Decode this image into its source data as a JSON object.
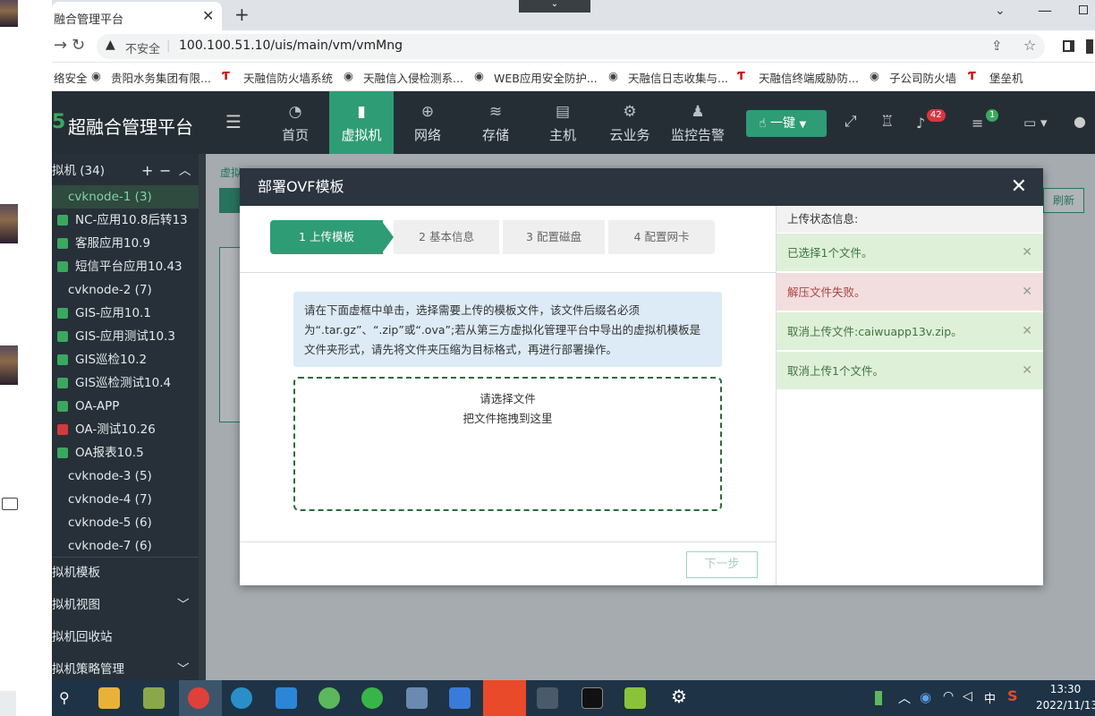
{
  "browser": {
    "tab_title": "融合管理平台",
    "security_label": "不安全",
    "url": "100.100.51.10/uis/main/vm/vmMng",
    "bookmarks": [
      "络安全",
      "贵阳水务集团有限...",
      "天融信防火墙系统",
      "天融信入侵检测系...",
      "WEB应用安全防护...",
      "天融信日志收集与...",
      "天融信终端威胁防...",
      "子公司防火墙",
      "堡垒机"
    ]
  },
  "app": {
    "logo_text": "超融合管理平台",
    "nav": [
      "首页",
      "虚拟机",
      "网络",
      "存储",
      "主机",
      "云业务",
      "监控告警"
    ],
    "one_click_label": "一键",
    "alarm_badge": "42",
    "task_badge": "1"
  },
  "sidebar": {
    "header": "拟机 (34)",
    "items": [
      {
        "label": "cvknode-1 (3)",
        "type": "host"
      },
      {
        "label": "NC-应用10.8后转13",
        "type": "vm"
      },
      {
        "label": "客服应用10.9",
        "type": "vm"
      },
      {
        "label": "短信平台应用10.43",
        "type": "vm"
      },
      {
        "label": "cvknode-2 (7)",
        "type": "host"
      },
      {
        "label": "GIS-应用10.1",
        "type": "vm"
      },
      {
        "label": "GIS-应用测试10.3",
        "type": "vm"
      },
      {
        "label": "GIS巡检10.2",
        "type": "vm"
      },
      {
        "label": "GIS巡检测试10.4",
        "type": "vm"
      },
      {
        "label": "OA-APP",
        "type": "vm"
      },
      {
        "label": "OA-测试10.26",
        "type": "vm-off"
      },
      {
        "label": "OA报表10.5",
        "type": "vm"
      },
      {
        "label": "cvknode-3 (5)",
        "type": "host"
      },
      {
        "label": "cvknode-4 (7)",
        "type": "host"
      },
      {
        "label": "cvknode-5 (6)",
        "type": "host"
      },
      {
        "label": "cvknode-7 (6)",
        "type": "host"
      }
    ],
    "sections": [
      "拟机模板",
      "拟机视图",
      "拟机回收站",
      "拟机策略管理"
    ]
  },
  "main": {
    "breadcrumb": "虚拟",
    "refresh_label": "刷新"
  },
  "modal": {
    "title": "部署OVF模板",
    "steps": [
      "1 上传模板",
      "2 基本信息",
      "3 配置磁盘",
      "4 配置网卡"
    ],
    "info_text": "请在下面虚框中单击，选择需要上传的模板文件，该文件后缀名必须为“.tar.gz”、“.zip”或“.ova”;若从第三方虚拟化管理平台中导出的虚拟机模板是文件夹形式，请先将文件夹压缩为目标格式，再进行部署操作。",
    "drop_line1": "请选择文件",
    "drop_line2": "把文件拖拽到这里",
    "next_label": "下一步",
    "status_title": "上传状态信息:",
    "messages": [
      {
        "text": "已选择1个文件。",
        "kind": "success"
      },
      {
        "text": "解压文件失败。",
        "kind": "error"
      },
      {
        "text": "取消上传文件:caiwuapp13v.zip。",
        "kind": "success"
      },
      {
        "text": "取消上传1个文件。",
        "kind": "success"
      }
    ],
    "colors": {
      "success": "#dff0d8",
      "error": "#f2dede",
      "active_step": "#2e9c75"
    }
  },
  "taskbar": {
    "time": "13:30",
    "date": "2022/11/13",
    "ime": "中"
  }
}
